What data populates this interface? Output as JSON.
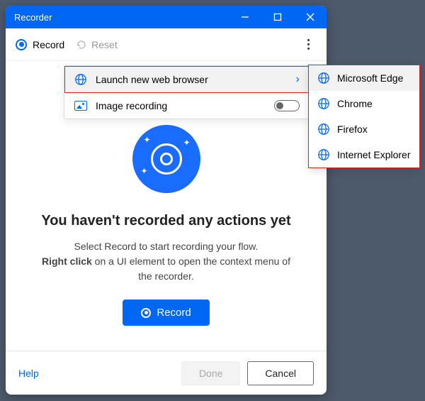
{
  "window": {
    "title": "Recorder"
  },
  "toolbar": {
    "record_label": "Record",
    "reset_label": "Reset"
  },
  "menu": {
    "launch_browser": "Launch new web browser",
    "image_recording": "Image recording"
  },
  "browsers": [
    {
      "label": "Microsoft Edge",
      "selected": true
    },
    {
      "label": "Chrome",
      "selected": false
    },
    {
      "label": "Firefox",
      "selected": false
    },
    {
      "label": "Internet Explorer",
      "selected": false
    }
  ],
  "empty_state": {
    "headline": "You haven't recorded any actions yet",
    "line1": "Select Record to start recording your flow.",
    "line2_bold": "Right click",
    "line2_rest": " on a UI element to open the context menu of the recorder.",
    "record_button": "Record"
  },
  "footer": {
    "help": "Help",
    "done": "Done",
    "cancel": "Cancel"
  }
}
